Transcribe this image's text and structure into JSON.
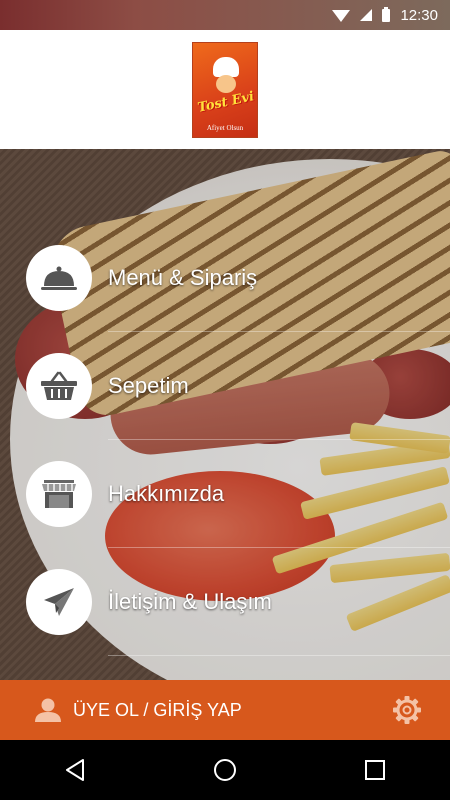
{
  "status_bar": {
    "time": "12:30",
    "icons": [
      "wifi-icon",
      "signal-icon",
      "battery-icon"
    ]
  },
  "header": {
    "logo": {
      "brand": "Tost Evi",
      "tagline": "Afiyet Olsun"
    }
  },
  "menu": {
    "items": [
      {
        "label": "Menü & Sipariş",
        "icon": "cloche-icon"
      },
      {
        "label": "Sepetim",
        "icon": "basket-icon"
      },
      {
        "label": "Hakkımızda",
        "icon": "store-icon"
      },
      {
        "label": "İletişim & Ulaşım",
        "icon": "paper-plane-icon"
      }
    ]
  },
  "bottom_bar": {
    "login_label": "ÜYE OL / GİRİŞ YAP",
    "user_icon": "user-icon",
    "settings_icon": "gear-icon"
  },
  "nav_bar": {
    "buttons": [
      "back-icon",
      "home-icon",
      "recents-icon"
    ]
  },
  "colors": {
    "accent": "#d7581c",
    "status_bar": "#7a2e2e",
    "header_bg": "#ffffff"
  }
}
